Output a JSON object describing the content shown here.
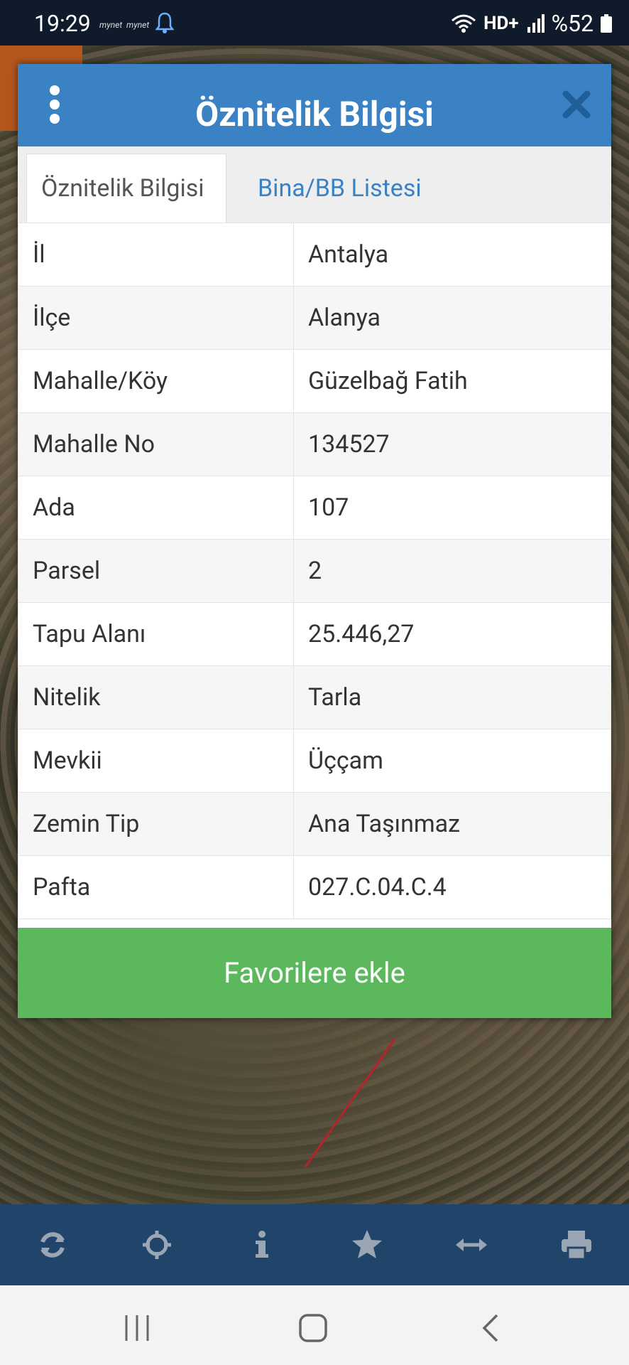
{
  "status": {
    "time": "19:29",
    "notif_1": "mynet",
    "notif_2": "mynet",
    "battery": "%52"
  },
  "modal": {
    "title": "Öznitelik Bilgisi",
    "tabs": [
      {
        "label": "Öznitelik Bilgisi",
        "active": true
      },
      {
        "label": "Bina/BB Listesi",
        "active": false
      }
    ],
    "rows": [
      {
        "key": "İl",
        "value": "Antalya"
      },
      {
        "key": "İlçe",
        "value": "Alanya"
      },
      {
        "key": "Mahalle/Köy",
        "value": "Güzelbağ Fatih"
      },
      {
        "key": "Mahalle No",
        "value": "134527"
      },
      {
        "key": "Ada",
        "value": "107"
      },
      {
        "key": "Parsel",
        "value": "2"
      },
      {
        "key": "Tapu Alanı",
        "value": "25.446,27"
      },
      {
        "key": "Nitelik",
        "value": "Tarla"
      },
      {
        "key": "Mevkii",
        "value": "Üççam"
      },
      {
        "key": "Zemin Tip",
        "value": "Ana Taşınmaz"
      },
      {
        "key": "Pafta",
        "value": "027.C.04.C.4"
      }
    ],
    "favorite_button": "Favorilere ekle"
  },
  "toolbar": {
    "icons": [
      "refresh-icon",
      "crosshair-icon",
      "info-icon",
      "star-icon",
      "measure-icon",
      "print-icon"
    ]
  },
  "colors": {
    "header_blue": "#3a82c4",
    "button_green": "#5cb85c",
    "toolbar_navy": "#21446b"
  }
}
